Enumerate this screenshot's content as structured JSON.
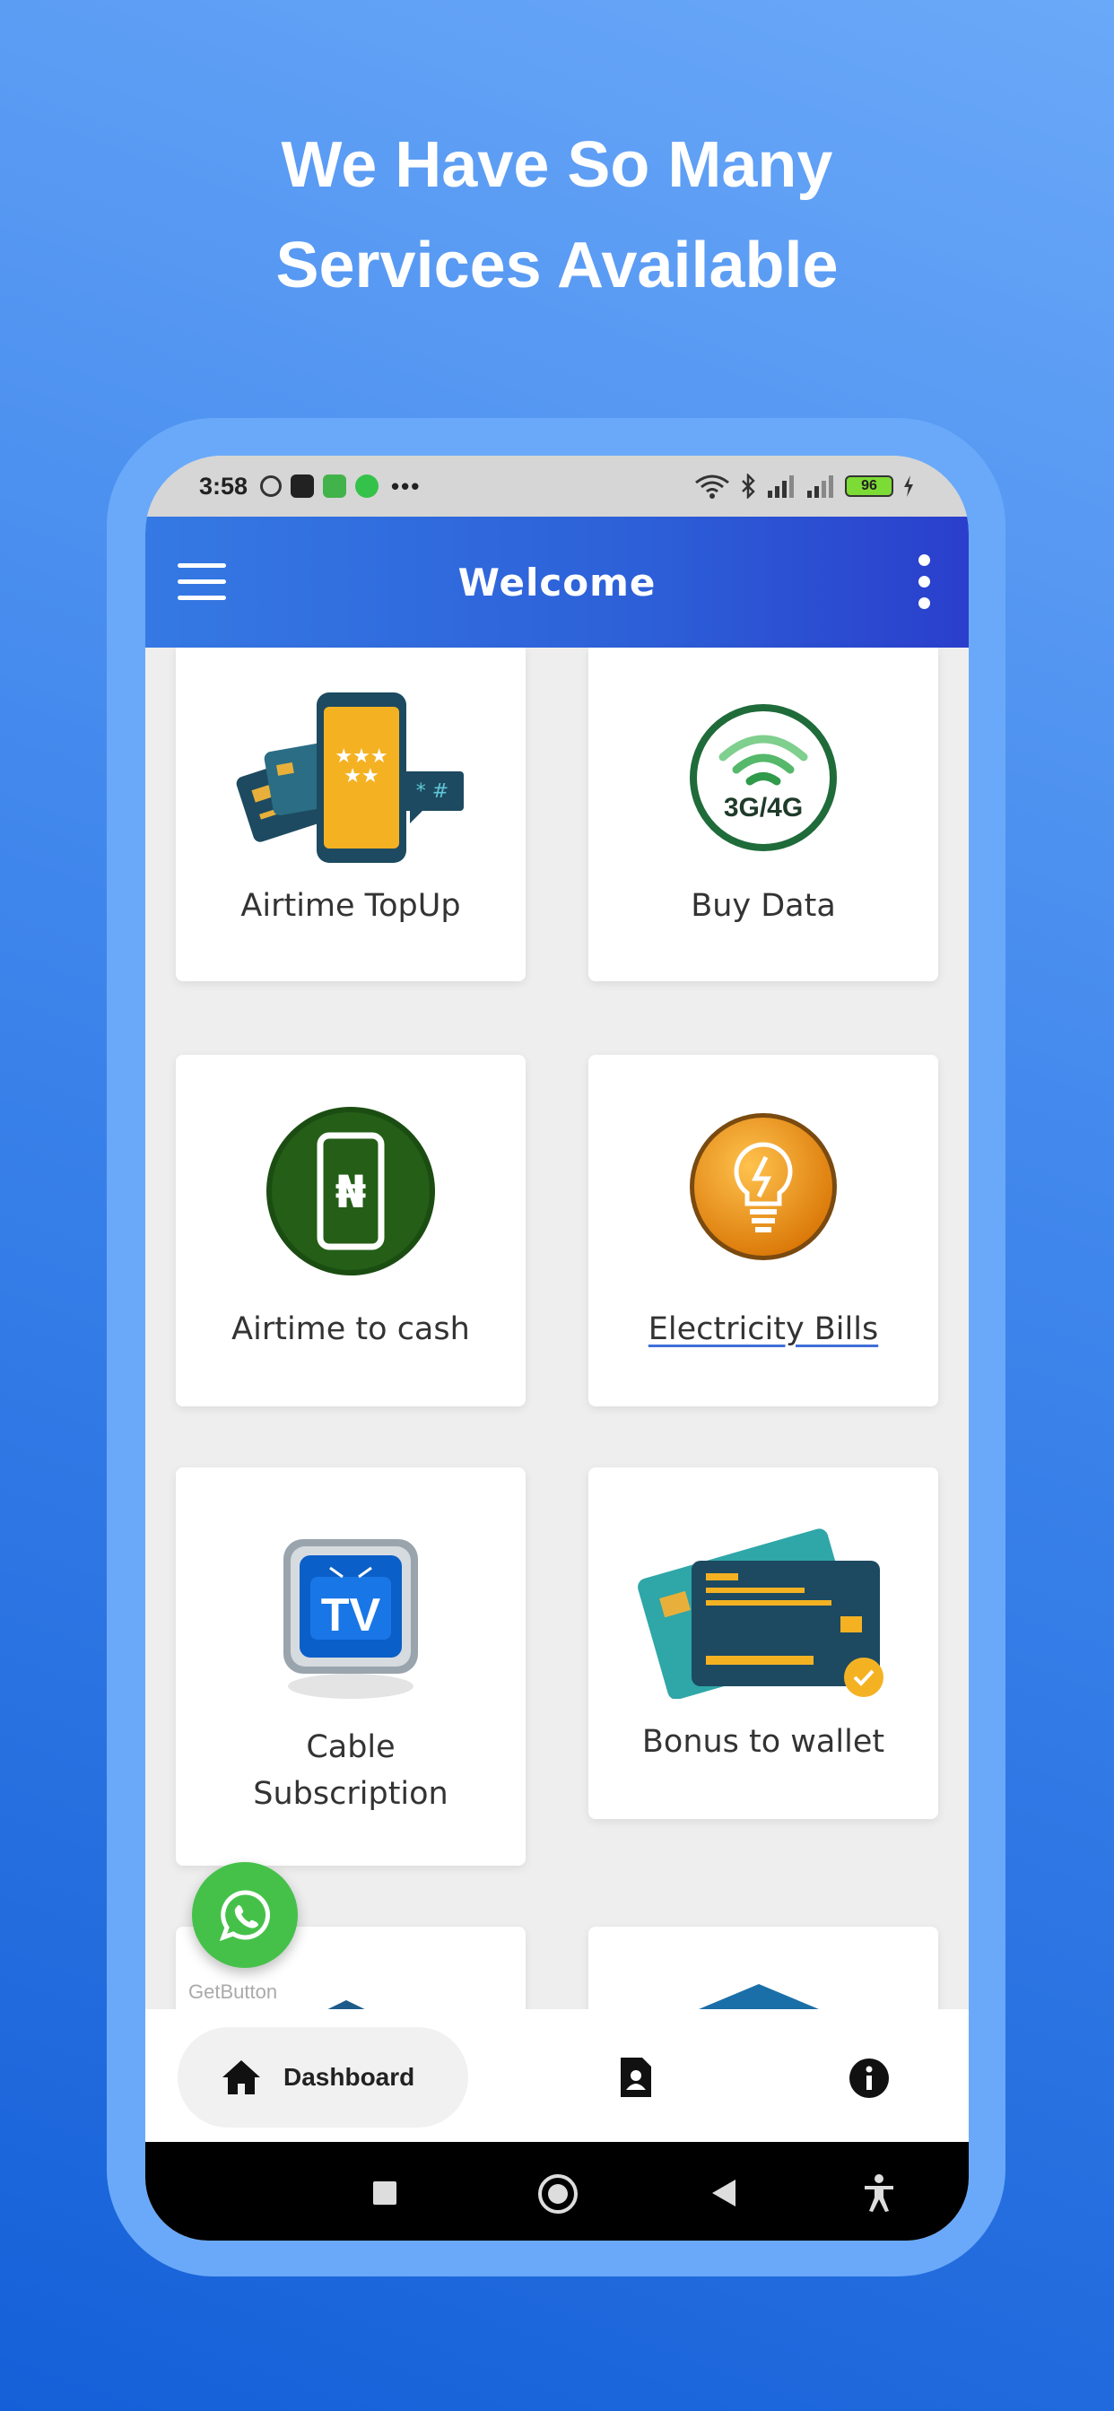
{
  "headline": {
    "line1": "We Have So Many",
    "line2": "Services Available"
  },
  "status_bar": {
    "time": "3:58",
    "more": "•••",
    "battery": "96"
  },
  "app_bar": {
    "title": "Welcome"
  },
  "services": [
    {
      "label": "Airtime TopUp",
      "icon": "phone-cards-icon"
    },
    {
      "label": "Buy Data",
      "icon": "wifi-3g4g-icon",
      "icon_text": "3G/4G"
    },
    {
      "label": "Airtime to cash",
      "icon": "phone-naira-icon",
      "icon_text": "₦"
    },
    {
      "label": "Electricity Bills",
      "icon": "lightbulb-icon"
    },
    {
      "label": "Cable Subscription",
      "label_line1": "Cable",
      "label_line2": "Subscription",
      "icon": "tv-icon",
      "icon_text": "TV"
    },
    {
      "label": "Bonus to wallet",
      "icon": "wallet-cards-icon"
    }
  ],
  "floating": {
    "whatsapp_caption": "GetButton"
  },
  "bottom_nav": {
    "dashboard_label": "Dashboard"
  },
  "colors": {
    "appbar_start": "#3579e4",
    "appbar_end": "#2a3fcc",
    "whatsapp_green": "#45c14a",
    "background_top": "#6aa8f8",
    "background_bottom": "#1560d8"
  }
}
